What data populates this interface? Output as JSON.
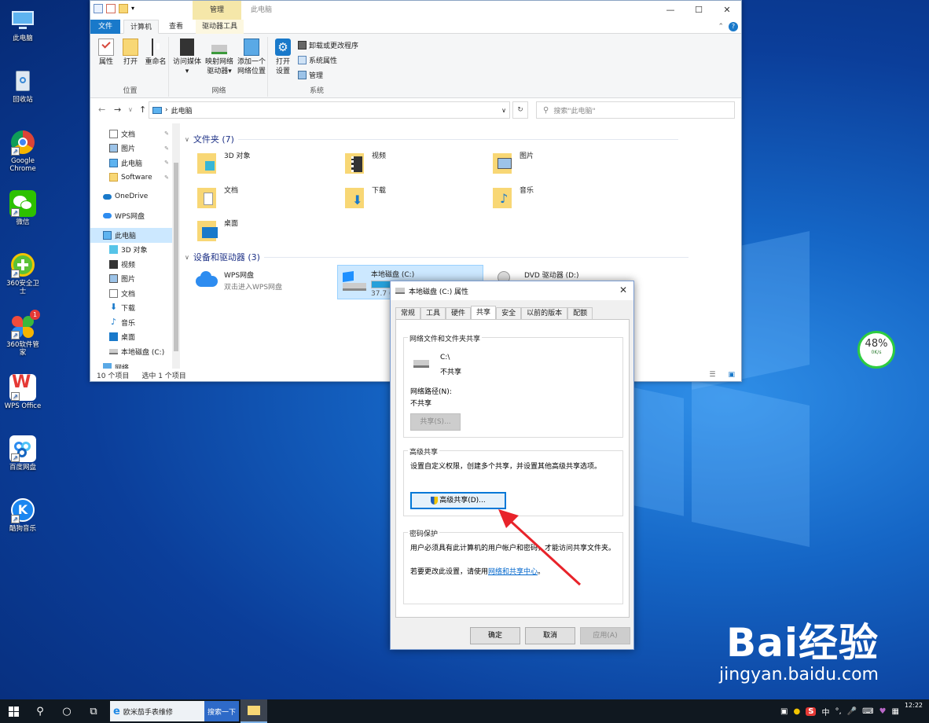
{
  "desktop": {
    "icons": [
      {
        "label": "此电脑",
        "name": "this-pc"
      },
      {
        "label": "回收站",
        "name": "recycle-bin"
      },
      {
        "label": "Google Chrome",
        "name": "chrome"
      },
      {
        "label": "微信",
        "name": "wechat"
      },
      {
        "label": "360安全卫士",
        "name": "360-security"
      },
      {
        "label": "360软件管家",
        "name": "360-software"
      },
      {
        "label": "WPS Office",
        "name": "wps-office"
      },
      {
        "label": "百度网盘",
        "name": "baidu-netdisk"
      },
      {
        "label": "酷狗音乐",
        "name": "kugou-music"
      }
    ],
    "badge_360": "1",
    "gauge_percent": "48%",
    "gauge_speed": "0K/s"
  },
  "explorer": {
    "context_tab": "管理",
    "title": "此电脑",
    "tabs": [
      "文件",
      "计算机",
      "查看",
      "驱动器工具"
    ],
    "ribbon": {
      "location_group": "位置",
      "network_group": "网络",
      "system_group": "系统",
      "properties": "属性",
      "open": "打开",
      "rename": "重命名",
      "media_line1": "访问媒体",
      "map_line1": "映射网络",
      "map_line2": "驱动器",
      "add_line1": "添加一个",
      "add_line2": "网络位置",
      "settings_line1": "打开",
      "settings_line2": "设置",
      "uninstall": "卸载或更改程序",
      "sys_props": "系统属性",
      "manage": "管理"
    },
    "address": "此电脑",
    "search_placeholder": "搜索\"此电脑\"",
    "nav": [
      {
        "label": "文档",
        "pin": true
      },
      {
        "label": "图片",
        "pin": true
      },
      {
        "label": "此电脑",
        "pin": true
      },
      {
        "label": "Software",
        "pin": true
      },
      {
        "label": "OneDrive",
        "pin": false
      },
      {
        "label": "WPS网盘",
        "pin": false
      },
      {
        "label": "此电脑",
        "pin": false
      },
      {
        "label": "3D 对象",
        "pin": false
      },
      {
        "label": "视频",
        "pin": false
      },
      {
        "label": "图片",
        "pin": false
      },
      {
        "label": "文档",
        "pin": false
      },
      {
        "label": "下载",
        "pin": false
      },
      {
        "label": "音乐",
        "pin": false
      },
      {
        "label": "桌面",
        "pin": false
      },
      {
        "label": "本地磁盘 (C:)",
        "pin": false
      },
      {
        "label": "网络",
        "pin": false
      }
    ],
    "folders_header": "文件夹 (7)",
    "folders": [
      "3D 对象",
      "视频",
      "图片",
      "文档",
      "下载",
      "音乐",
      "桌面"
    ],
    "devices_header": "设备和驱动器 (3)",
    "wps_title": "WPS网盘",
    "wps_sub": "双击进入WPS网盘",
    "drive_c": "本地磁盘 (C:)",
    "drive_c_free": "37.7 (",
    "drive_c_fill": 0.45,
    "dvd": "DVD 驱动器 (D:)",
    "status_count": "10 个项目",
    "status_sel": "选中 1 个项目"
  },
  "dialog": {
    "title": "本地磁盘 (C:) 属性",
    "tabs": [
      "常规",
      "工具",
      "硬件",
      "共享",
      "安全",
      "以前的版本",
      "配额"
    ],
    "net_group": "网络文件和文件夹共享",
    "path": "C:\\",
    "path_state": "不共享",
    "net_path_label": "网络路径(N):",
    "net_path_value": "不共享",
    "share_btn": "共享(S)...",
    "adv_group": "高级共享",
    "adv_desc": "设置自定义权限，创建多个共享，并设置其他高级共享选项。",
    "adv_btn": "高级共享(D)...",
    "pwd_group": "密码保护",
    "pwd_desc": "用户必须具有此计算机的用户帐户和密码，才能访问共享文件夹。",
    "pwd_link_prefix": "若要更改此设置，请使用",
    "pwd_link": "网络和共享中心",
    "pwd_link_suffix": "。",
    "ok": "确定",
    "cancel": "取消",
    "apply": "应用(A)"
  },
  "taskbar": {
    "ie_label": "欧米茄手表维修",
    "search_btn": "搜索一下",
    "ime": "中",
    "clock": "12:22"
  },
  "watermark": {
    "line1": "Bai经验",
    "line2": "jingyan.baidu.com"
  }
}
